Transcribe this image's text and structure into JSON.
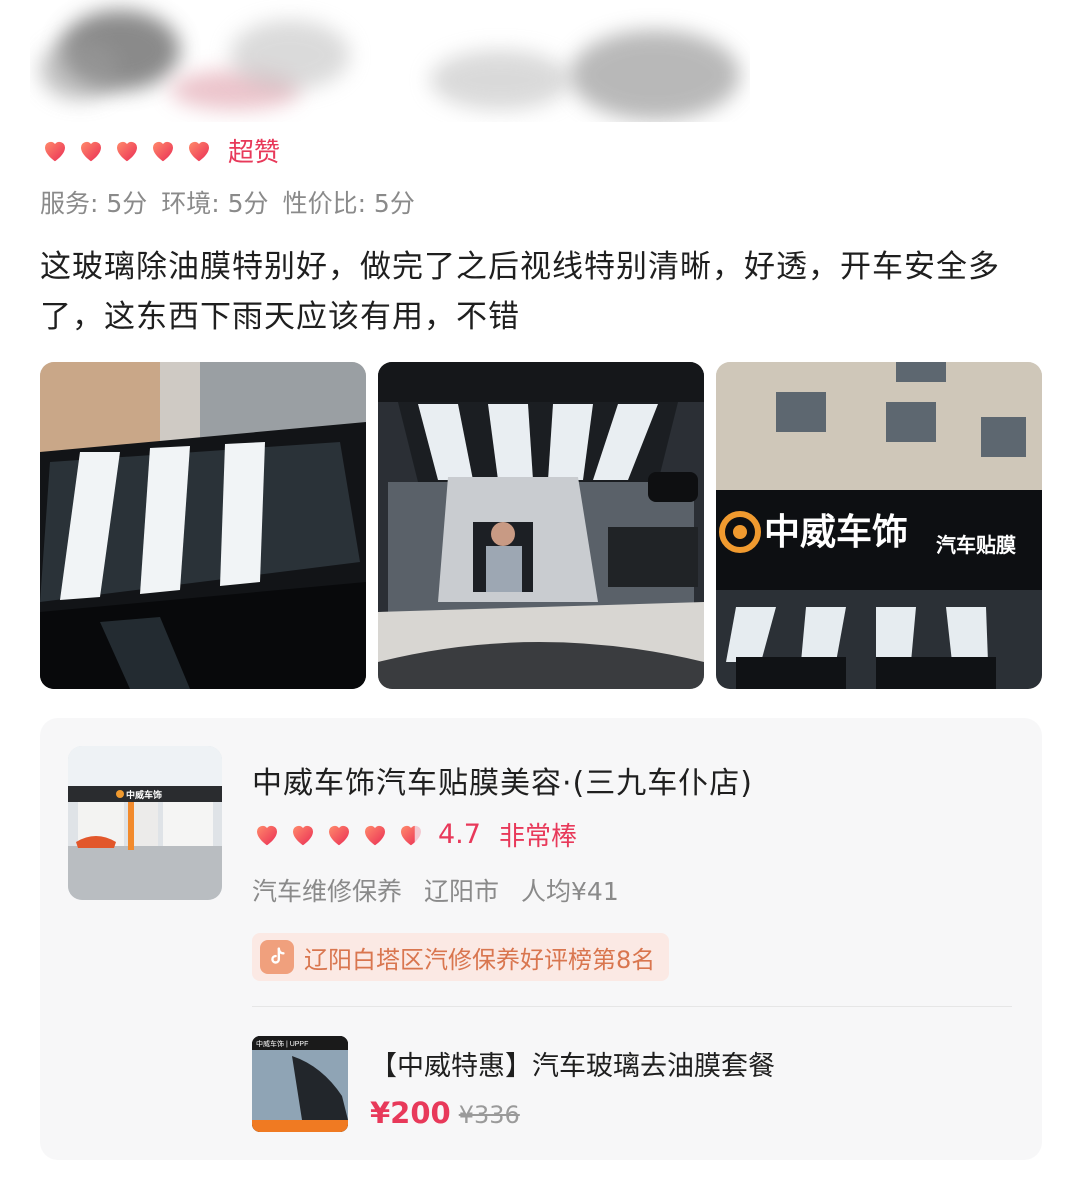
{
  "review": {
    "rating_label": "超赞",
    "stars": 5,
    "scores": [
      "服务: 5分",
      "环境: 5分",
      "性价比: 5分"
    ],
    "text": "这玻璃除油膜特别好，做完了之后视线特别清晰，好透，开车安全多了，这东西下雨天应该有用，不错",
    "photos": [
      "photo-car-windshield",
      "photo-workshop-hatchback",
      "photo-storefront-sign"
    ],
    "storefront_sign": "中威车饰",
    "storefront_sub": "汽车贴膜"
  },
  "shop": {
    "name": "中威车饰汽车贴膜美容·(三九车仆店)",
    "score": "4.7",
    "score_label": "非常棒",
    "category": "汽车维修保养",
    "city": "辽阳市",
    "avg_price": "人均¥41",
    "rank_text": "辽阳白塔区汽修保养好评榜第8名",
    "thumb_sign": "中威车饰"
  },
  "deal": {
    "title": "【中威特惠】汽车玻璃去油膜套餐",
    "price": "¥200",
    "original_price": "¥336",
    "thumb_brand": "中威车饰 | UPPF"
  },
  "colors": {
    "accent": "#e8395a",
    "rank_orange": "#d9764f"
  }
}
